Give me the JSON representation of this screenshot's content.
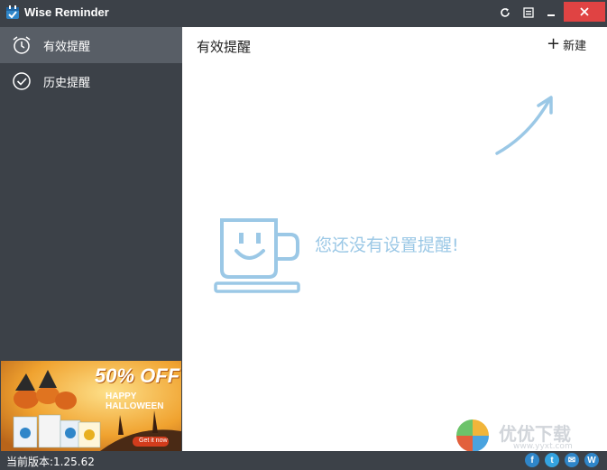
{
  "window": {
    "title": "Wise Reminder",
    "accent_close": "#e04343"
  },
  "sidebar": {
    "items": [
      {
        "label": "有效提醒",
        "icon": "alarm-clock-icon",
        "active": true
      },
      {
        "label": "历史提醒",
        "icon": "check-circle-icon",
        "active": false
      }
    ]
  },
  "ad": {
    "headline": "50% OFF",
    "subtitle": "HAPPY HALLOWEEN",
    "cta": "Get it now"
  },
  "main": {
    "title": "有效提醒",
    "new_label": "新建",
    "empty_message": "您还没有设置提醒!"
  },
  "status": {
    "version": "当前版本:1.25.62",
    "social": [
      {
        "icon": "facebook-icon",
        "glyph": "f"
      },
      {
        "icon": "twitter-icon",
        "glyph": "t"
      },
      {
        "icon": "email-icon",
        "glyph": "✉"
      },
      {
        "icon": "wise-icon",
        "glyph": "W"
      }
    ]
  },
  "watermark": {
    "text": "优优下载",
    "url": "www.yyxt.com"
  },
  "colors": {
    "dark_bg": "#3c4148",
    "active_item": "#585e66",
    "illustration": "#9bc8e6"
  }
}
